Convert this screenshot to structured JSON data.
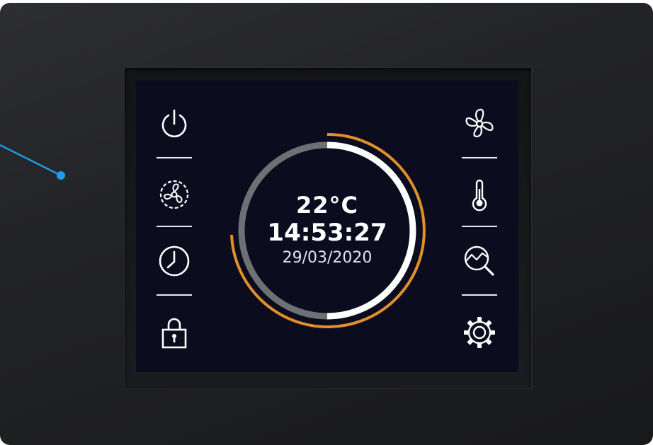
{
  "readout": {
    "temperature": "22°C",
    "time": "14:53:27",
    "date": "29/03/2020"
  },
  "left_icons": [
    "power-icon",
    "fan-speed-icon",
    "clock-icon",
    "lock-icon"
  ],
  "right_icons": [
    "fan-icon",
    "thermometer-icon",
    "trend-search-icon",
    "settings-gear-icon"
  ],
  "colors": {
    "screen": "#0b0d1e",
    "icon": "#ffffff",
    "ring_white": "#ffffff",
    "ring_gray": "#6e7075",
    "ring_orange": "#e38f2c",
    "pointer": "#1e9be6"
  }
}
